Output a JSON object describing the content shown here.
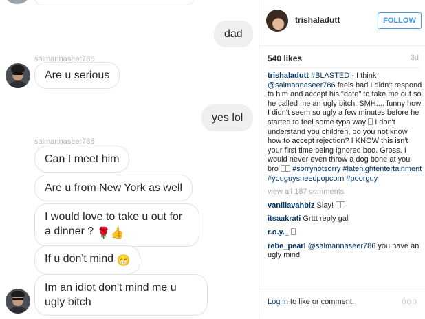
{
  "thread": {
    "sender_name": "salmannaseer786",
    "me_messages": {
      "dad": "dad",
      "yes": "yes lol"
    },
    "them_messages": {
      "serious": "Are u serious",
      "meet": "Can I meet him",
      "newyork": "Are u from New York as well",
      "dinner": "I would love to take u out for a dinner ?",
      "mind": "If u don't mind",
      "idiot": "Im an idiot don't mind me u ugly bitch"
    },
    "emoji": {
      "rose": "🌹",
      "thumbs": "👍",
      "grin": "😁"
    }
  },
  "post": {
    "username": "trishaladutt",
    "follow_label": "FOLLOW",
    "likes": "540 likes",
    "age": "3d",
    "caption_user": "trishaladutt",
    "caption_parts": {
      "tag": "#BLASTED",
      "p1": " - I think ",
      "mention": "@salmannaseer786",
      "p2": " feels bad I didn't respond to him and accept his \"date\" to take me out so he called me an ugly bitch. SMH.... funny how I didn't seem so ugly a few minutes before he started to feel some typa way ",
      "p3": " I don't understand you children, do you not know how to accept rejection? I KNOW this isn't your first time being ignored boo. Gross. I would never even throw a dog bone at you bro ",
      "tags": " #sorrynotsorry #latenightentertainment #youguysneedpopcorn #poorguy"
    },
    "view_all": "view all 187 comments",
    "comments": [
      {
        "user": "vanillavahbiz",
        "text": "Slay! "
      },
      {
        "user": "itsaakrati",
        "text": "Grttt reply gal"
      },
      {
        "user": "r.o.y._",
        "text": ""
      },
      {
        "user": "rebe_pearl",
        "mention": "@salmannaseer786",
        "text": " you have an ugly mind"
      }
    ],
    "login_link": "Log in",
    "login_rest": " to like or comment.",
    "more": "ooo"
  }
}
